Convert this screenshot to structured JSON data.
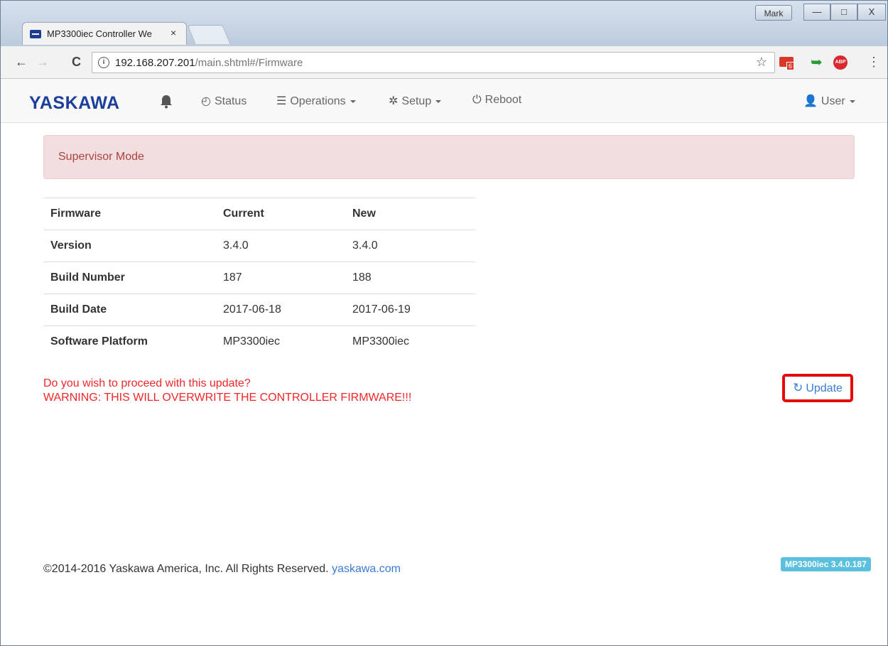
{
  "browser": {
    "tab_title": "MP3300iec Controller We",
    "tab_close": "×",
    "profile_name": "Mark",
    "window_controls": {
      "minimize": "—",
      "maximize": "□",
      "close": "X"
    },
    "back": "←",
    "forward": "→",
    "reload": "C",
    "url_host": "192.168.207.201",
    "url_path": "/main.shtml#/Firmware",
    "bookmark_icon": "☆",
    "gmail_badge": "6",
    "abp_label": "ABP",
    "menu_icon": "⋮"
  },
  "navbar": {
    "brand": "YASKAWA",
    "items": [
      {
        "label": "Status",
        "icon": "clock-icon"
      },
      {
        "label": "Operations",
        "icon": "server-icon"
      },
      {
        "label": "Setup",
        "icon": "cog-icon"
      },
      {
        "label": "Reboot",
        "icon": "power-icon"
      }
    ],
    "user": "User"
  },
  "alert": {
    "text": "Supervisor Mode"
  },
  "firmware_table": {
    "headers": [
      "Firmware",
      "Current",
      "New"
    ],
    "rows": [
      [
        "Version",
        "3.4.0",
        "3.4.0"
      ],
      [
        "Build Number",
        "187",
        "188"
      ],
      [
        "Build Date",
        "2017-06-18",
        "2017-06-19"
      ],
      [
        "Software Platform",
        "MP3300iec",
        "MP3300iec"
      ]
    ]
  },
  "confirm": {
    "question": "Do you wish to proceed with this update?",
    "warning": "WARNING: THIS WILL OVERWRITE THE CONTROLLER FIRMWARE!!!"
  },
  "update_button": {
    "label": "Update"
  },
  "footer": {
    "copyright": "©2014-2016 Yaskawa America, Inc. All Rights Reserved.",
    "link": "yaskawa.com",
    "version_badge": "MP3300iec 3.4.0.187"
  },
  "colors": {
    "brand": "#1b3f9a",
    "warning": "#f0272a",
    "link": "#3a7bd5",
    "highlight": "#e30a0a",
    "badge": "#5bc0de"
  }
}
